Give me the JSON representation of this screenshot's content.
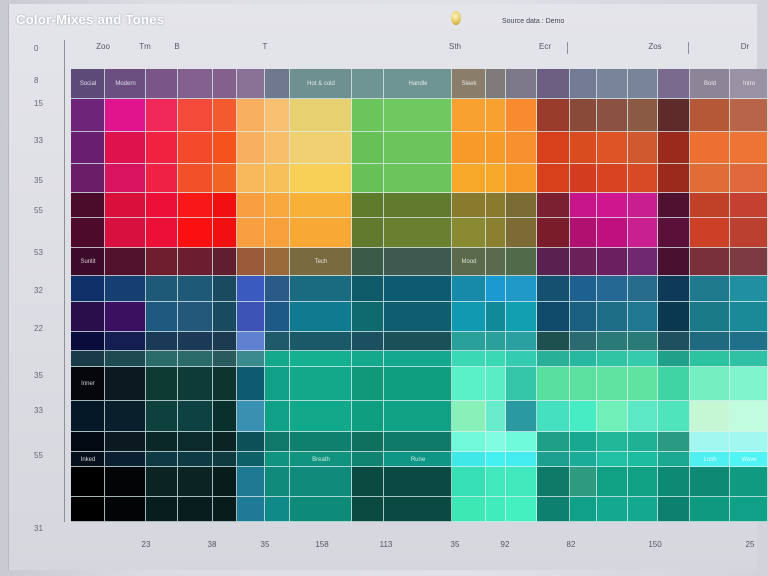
{
  "header": {
    "title": "Color-Mixes and Tones",
    "source": "Source data : Demo"
  },
  "chart_data": {
    "type": "heatmap",
    "title": "Color-Mixes and Tones",
    "x_ticks_top": [
      "Zoo",
      "Tm",
      "B",
      "T",
      "Sth",
      "Ecr",
      "Zos",
      "Dr"
    ],
    "x_ticks_bottom": [
      "23",
      "38",
      "35",
      "158",
      "113",
      "35",
      "92",
      "82",
      "150",
      "25"
    ],
    "y_ticks": [
      "0",
      "8",
      "15",
      "33",
      "35",
      "55",
      "53",
      "32",
      "22",
      "35",
      "33",
      "55",
      "31"
    ],
    "cell_labels": [
      {
        "row": 0,
        "col": 0,
        "text": "Social"
      },
      {
        "row": 0,
        "col": 1,
        "text": "Modern"
      },
      {
        "row": 0,
        "col": 7,
        "text": "Hot & cold"
      },
      {
        "row": 0,
        "col": 9,
        "text": "Handle"
      },
      {
        "row": 0,
        "col": 10,
        "text": "Sleek"
      },
      {
        "row": 0,
        "col": 18,
        "text": "Bold"
      },
      {
        "row": 0,
        "col": 19,
        "text": "Intro"
      },
      {
        "row": 6,
        "col": 0,
        "text": "Sunlit"
      },
      {
        "row": 6,
        "col": 7,
        "text": "Tech"
      },
      {
        "row": 6,
        "col": 10,
        "text": "Mood"
      },
      {
        "row": 11,
        "col": 0,
        "text": "Inner"
      },
      {
        "row": 14,
        "col": 0,
        "text": "Inked"
      },
      {
        "row": 14,
        "col": 7,
        "text": "Breath"
      },
      {
        "row": 14,
        "col": 9,
        "text": "Rune"
      },
      {
        "row": 14,
        "col": 18,
        "text": "Lush"
      },
      {
        "row": 14,
        "col": 19,
        "text": "Wave"
      }
    ],
    "cell_colors": [
      [
        "#5e4a78",
        "#6a4f80",
        "#7a5688",
        "#83608e",
        "#84618c",
        "#8a7296",
        "#70788e",
        "#6f9090",
        "#6f9494",
        "#6e9493",
        "#8a7d6a",
        "#7e7a7a",
        "#7c7888",
        "#6c5f82",
        "#727a94",
        "#7a8499",
        "#7a8499",
        "#7a6a8e",
        "#8e8498",
        "#9a92a4"
      ],
      [
        "#6e2478",
        "#e0148c",
        "#f0285a",
        "#f44a3a",
        "#f45a30",
        "#f8b060",
        "#f8c070",
        "#e6d070",
        "#6cc45c",
        "#70c860",
        "#f8a030",
        "#f8a030",
        "#f88a30",
        "#9a3c2c",
        "#8a4a3a",
        "#8a5040",
        "#8a5a44",
        "#5e2a2a",
        "#b45838",
        "#b86448"
      ],
      [
        "#6a1e70",
        "#e0124e",
        "#f02240",
        "#f24a2a",
        "#f6521e",
        "#f8b060",
        "#f8bf68",
        "#f0d070",
        "#68c058",
        "#6cc45c",
        "#f89a28",
        "#f89a28",
        "#f89030",
        "#d8401c",
        "#d84c20",
        "#de5426",
        "#d05a30",
        "#9a2a1c",
        "#ee7030",
        "#ee7436"
      ],
      [
        "#6a1e68",
        "#d81460",
        "#f02244",
        "#f25028",
        "#f26424",
        "#f8b85c",
        "#f8c058",
        "#f8d058",
        "#68c058",
        "#6cc45c",
        "#f8a828",
        "#f8a828",
        "#f89a28",
        "#d8401c",
        "#d43c20",
        "#d84422",
        "#d84a26",
        "#9a2a1c",
        "#e06c38",
        "#e0683a"
      ],
      [
        "#4a0a2a",
        "#d8103a",
        "#ec1038",
        "#f81818",
        "#f01010",
        "#f8a040",
        "#f8a83c",
        "#f8b038",
        "#5e7a2a",
        "#627a2e",
        "#8a7a2e",
        "#8a7a2e",
        "#7a6a34",
        "#7a2030",
        "#c8148a",
        "#d0168e",
        "#c81e90",
        "#501030",
        "#c04028",
        "#c44030"
      ],
      [
        "#4e0a2a",
        "#d81040",
        "#ec1038",
        "#fa1010",
        "#f01010",
        "#f8a040",
        "#f8a03c",
        "#f8a834",
        "#627a2e",
        "#6a8030",
        "#8a8a32",
        "#8a8030",
        "#7e6a34",
        "#7a1c2a",
        "#b01070",
        "#c01080",
        "#c8208e",
        "#5a1038",
        "#cc4028",
        "#bc4030"
      ],
      [
        "#3c0a2a",
        "#52122c",
        "#6e1e2e",
        "#6a1e30",
        "#5e1e30",
        "#9a5a3a",
        "#9a6a3a",
        "#7a6a40",
        "#3c5a48",
        "#3e5a50",
        "#5a6a4a",
        "#5a6a4a",
        "#506a4a",
        "#5a2050",
        "#6a2058",
        "#6a2060",
        "#702870",
        "#4a1030",
        "#7a3038",
        "#7a3a40"
      ],
      [
        "#10306a",
        "#163e70",
        "#1e5a78",
        "#1e5a78",
        "#1a4a60",
        "#3a5ac0",
        "#2a5a88",
        "#1a6a80",
        "#0e5a68",
        "#0e5a70",
        "#168aa8",
        "#1a9ad0",
        "#2098c8",
        "#145070",
        "#1e6090",
        "#266894",
        "#286c8c",
        "#0e3a58",
        "#207a8e",
        "#2090a0"
      ],
      [
        "#2a0e4c",
        "#3c1060",
        "#1e5a80",
        "#24587a",
        "#1a4a60",
        "#3e54b4",
        "#1e5a88",
        "#107a90",
        "#0e6a6c",
        "#0e5e70",
        "#1099b0",
        "#108a98",
        "#10a0b0",
        "#104a6a",
        "#1a5e80",
        "#1e6e88",
        "#207890",
        "#0a3850",
        "#1a7a88",
        "#1a8a98"
      ],
      [
        "#0a0c3c",
        "#141e50",
        "#1a3a58",
        "#1a3a58",
        "#1a3a50",
        "#6080d0",
        "#1e5a6a",
        "#1a5a68",
        "#1a5060",
        "#1a5058",
        "#2aa09a",
        "#2aa09a",
        "#2aa0a0",
        "#1e5050",
        "#2a6a70",
        "#2a7a78",
        "#2a7a78",
        "#1e5060",
        "#206a80",
        "#20708a"
      ],
      [
        "#1a3a48",
        "#1e4a52",
        "#2a6a68",
        "#2a6a68",
        "#2a5a5e",
        "#3a8a8e",
        "#14a88c",
        "#14b090",
        "#14a88c",
        "#14a890",
        "#3ad8b4",
        "#3ad8b4",
        "#34ccb0",
        "#28b098",
        "#28b8a0",
        "#30c4a4",
        "#34ccac",
        "#20a088",
        "#2cc4a0",
        "#30c0a4"
      ],
      [
        "#04060c",
        "#0a1a20",
        "#0e3a34",
        "#0e3a38",
        "#0e3430",
        "#0e5a70",
        "#10a088",
        "#12a88a",
        "#109878",
        "#109e80",
        "#5af0c8",
        "#5aecc4",
        "#34c4a8",
        "#58e0a0",
        "#5ce0a0",
        "#60e2a0",
        "#60e2a0",
        "#40d4a4",
        "#74f0c0",
        "#80f4cc"
      ],
      [
        "#041828",
        "#08202c",
        "#0e403e",
        "#0e4242",
        "#0a302e",
        "#3a90b0",
        "#10a088",
        "#12a88a",
        "#109e80",
        "#10a084",
        "#88f0b8",
        "#68eccc",
        "#2a9aa0",
        "#44e0c0",
        "#48ecc4",
        "#70f0b8",
        "#5ce8c4",
        "#50e4bc",
        "#c4f8d4",
        "#c0fce0"
      ],
      [
        "#040a14",
        "#0a1a20",
        "#0a2828",
        "#0a2a2c",
        "#0a2424",
        "#0e5058",
        "#10786a",
        "#10806e",
        "#10705e",
        "#107a6a",
        "#70f8d8",
        "#80fce0",
        "#70fadc",
        "#1ea088",
        "#18a890",
        "#20b898",
        "#20b094",
        "#2a9a82",
        "#a0f8f0",
        "#a0f8f0"
      ],
      [
        "#06101c",
        "#0a2030",
        "#0e3a44",
        "#0e3a44",
        "#0e3a40",
        "#0e6068",
        "#109480",
        "#109480",
        "#108470",
        "#109684",
        "#40e8e8",
        "#44f0f0",
        "#44ecf0",
        "#1ea090",
        "#1aac98",
        "#20c0a4",
        "#1cbca0",
        "#1aa890",
        "#50f0f0",
        "#50f4f4"
      ],
      [
        "#000000",
        "#020406",
        "#0a2424",
        "#0a2424",
        "#081c1c",
        "#1e7890",
        "#108a7a",
        "#108a7a",
        "#0a4a40",
        "#0a4a42",
        "#36e0b4",
        "#40e8bc",
        "#40e8bc",
        "#0e7a68",
        "#2e9a80",
        "#10a084",
        "#10a084",
        "#0e8a74",
        "#0e8a74",
        "#109a82"
      ],
      [
        "#000000",
        "#020406",
        "#081e1e",
        "#081e1e",
        "#081c1c",
        "#1e7a96",
        "#108a88",
        "#0e8a78",
        "#0a4a40",
        "#0a4a42",
        "#3ee8b4",
        "#40ecbc",
        "#44f0c0",
        "#0e8070",
        "#10a08a",
        "#14a890",
        "#14a890",
        "#0e8070",
        "#0e9a80",
        "#10a088"
      ]
    ]
  }
}
